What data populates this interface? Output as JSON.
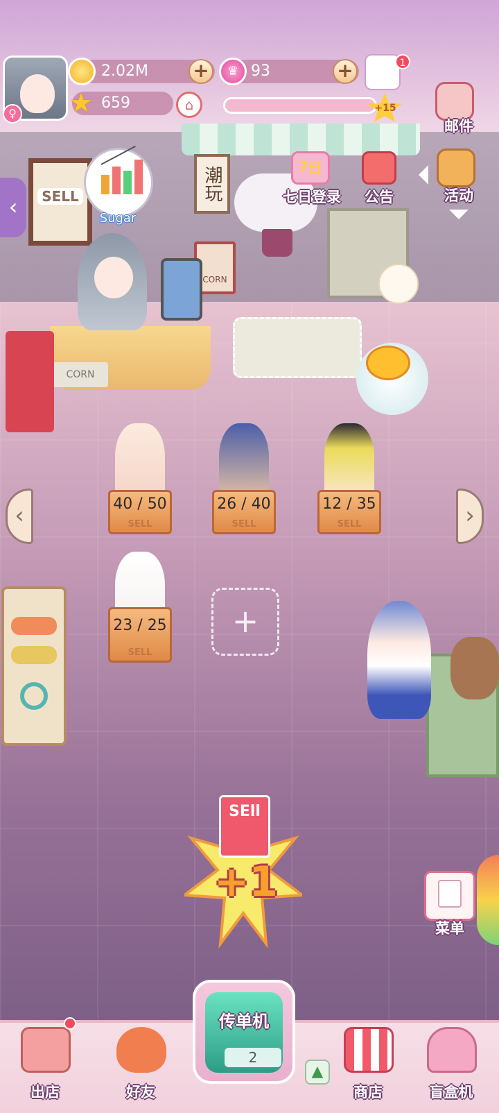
{
  "player": {
    "avatar_icon": "player-avatar",
    "gender_icon": "female-symbol"
  },
  "resources": {
    "coins": "2.02M",
    "crowns": "93",
    "stars": "659",
    "quest_badge": "1",
    "level_bonus": "+15"
  },
  "top_right": {
    "mail_label": "邮件",
    "events_label": "活动"
  },
  "banner": {
    "seven_day_label": "七日登录",
    "seven_day_badge": "7日",
    "notice_label": "公告"
  },
  "shop": {
    "sign_text": "潮玩",
    "board_text": "SELL",
    "cashier_name": "Sugar",
    "counter_text": "CORN"
  },
  "displays": [
    {
      "count": "40 / 50"
    },
    {
      "count": "26 / 40"
    },
    {
      "count": "12 / 35"
    },
    {
      "count": "23 / 25"
    }
  ],
  "empty_slot_symbol": "+",
  "promo": {
    "card_text": "SEll",
    "bonus": "+1"
  },
  "side_menu": {
    "label": "菜单"
  },
  "flyer_machine": {
    "label": "传单机",
    "count": "2"
  },
  "bottom_nav": {
    "go_out": "出店",
    "friends": "好友",
    "shop": "商店",
    "blind_box": "盲盒机"
  },
  "colors": {
    "accent_pink": "#e36a8b",
    "coin_gold": "#f2b224",
    "teal": "#2d9c86"
  }
}
